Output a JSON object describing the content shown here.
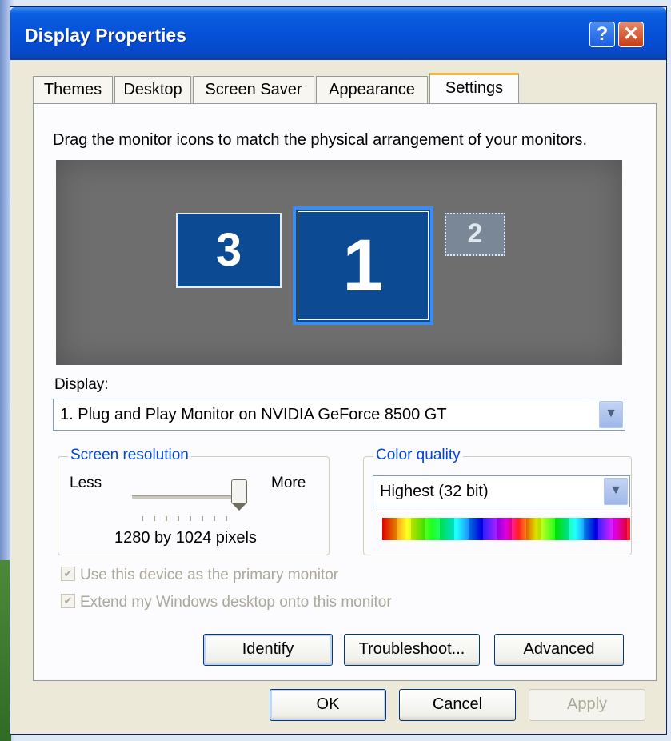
{
  "window": {
    "title": "Display Properties",
    "help_glyph": "?",
    "close_glyph": "✕"
  },
  "tabs": [
    {
      "label": "Themes"
    },
    {
      "label": "Desktop"
    },
    {
      "label": "Screen Saver"
    },
    {
      "label": "Appearance"
    },
    {
      "label": "Settings",
      "active": true
    }
  ],
  "settings": {
    "instruction": "Drag the monitor icons to match the physical arrangement of your monitors.",
    "monitors": [
      {
        "number": "3"
      },
      {
        "number": "1",
        "selected": true
      },
      {
        "number": "2",
        "inactive": true
      }
    ],
    "display_label": "Display:",
    "display_value": "1. Plug and Play Monitor on NVIDIA GeForce 8500 GT",
    "screen_resolution": {
      "legend": "Screen resolution",
      "less": "Less",
      "more": "More",
      "value": "1280 by 1024 pixels",
      "slider_position": 1.0
    },
    "color_quality": {
      "legend": "Color quality",
      "value": "Highest (32 bit)"
    },
    "checkboxes": [
      {
        "label": "Use this device as the primary monitor",
        "checked": true,
        "disabled": true
      },
      {
        "label": "Extend my Windows desktop onto this monitor",
        "checked": true,
        "disabled": true
      }
    ],
    "buttons": {
      "identify": "Identify",
      "troubleshoot": "Troubleshoot...",
      "advanced": "Advanced"
    }
  },
  "dialog_buttons": {
    "ok": "OK",
    "cancel": "Cancel",
    "apply": "Apply"
  },
  "colors": {
    "titlebar": "#0551d8",
    "monitor_fill": "#0d4a94",
    "group_legend": "#0046d5",
    "active_tab_accent": "#f5b741"
  },
  "icons": {
    "dropdown": "chevron-down-icon",
    "checkbox": "checkmark-icon"
  }
}
